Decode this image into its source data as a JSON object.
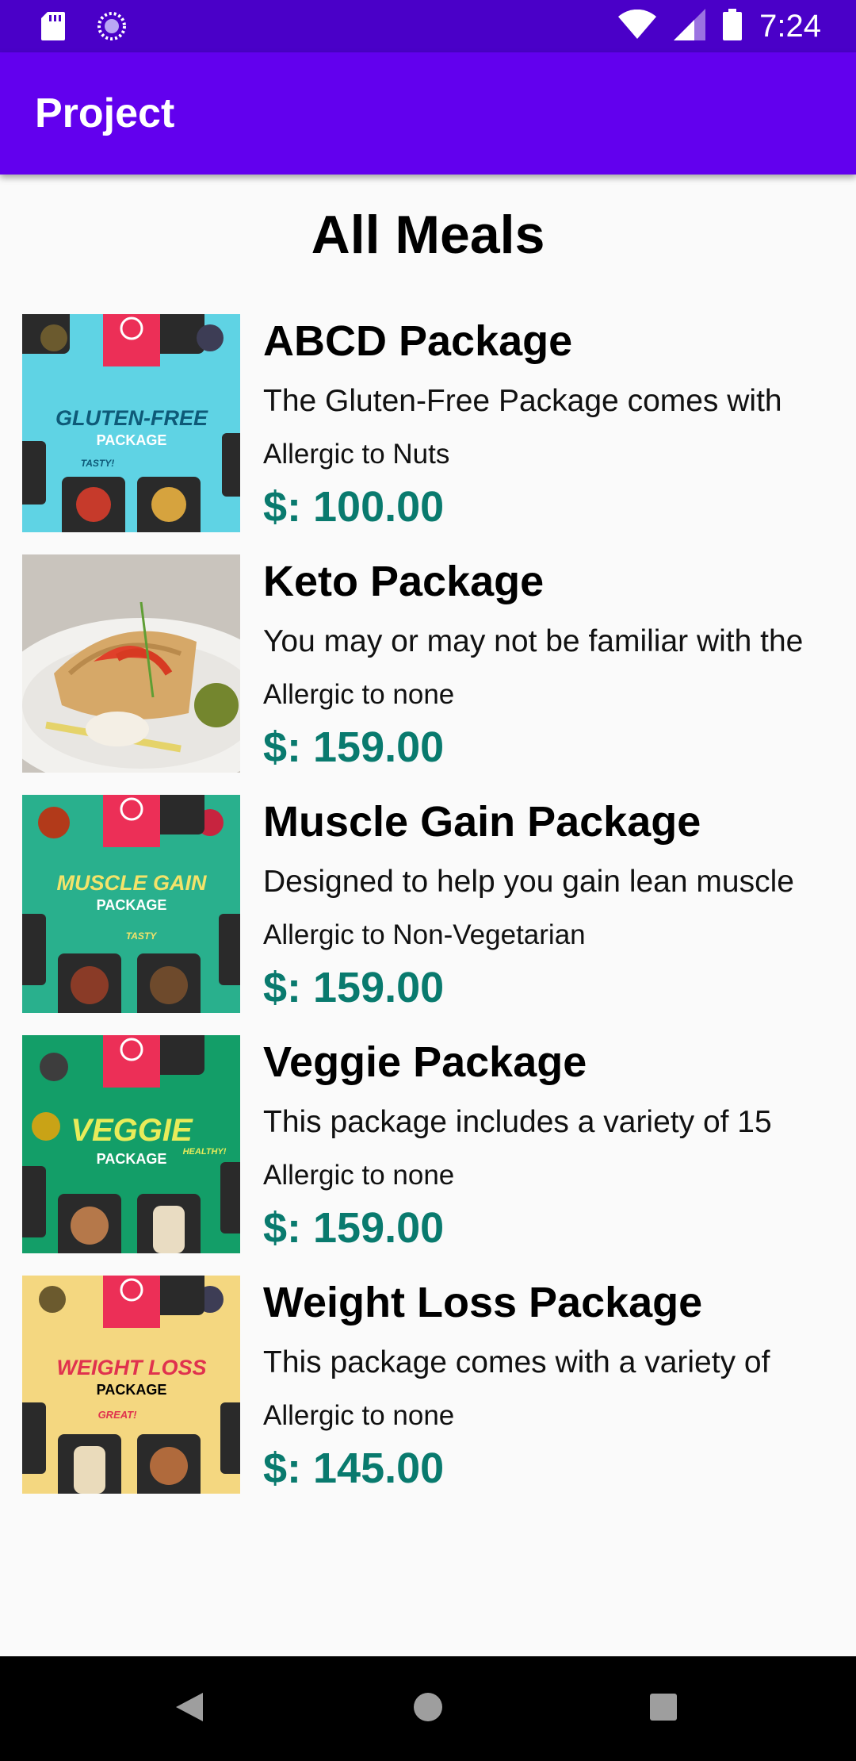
{
  "status_bar": {
    "time": "7:24",
    "icons": [
      "sd-card-icon",
      "sync-icon",
      "wifi-icon",
      "signal-icon",
      "battery-icon"
    ]
  },
  "app_bar": {
    "title": "Project"
  },
  "page": {
    "title": "All Meals"
  },
  "meals": [
    {
      "name": "ABCD Package",
      "description": "The Gluten-Free Package comes with",
      "allergy": "Allergic to Nuts",
      "price": "$: 100.00",
      "image": {
        "kind": "poster",
        "bg": "#5fd3e4",
        "line1": "GLUTEN-FREE",
        "line2": "PACKAGE",
        "line3": "TASTY!",
        "text_color": "#0e5a78"
      }
    },
    {
      "name": "Keto Package",
      "description": "You may or may not be familiar with the",
      "allergy": "Allergic to none",
      "price": "$: 159.00",
      "image": {
        "kind": "photo",
        "bg": "#d9d9d9"
      }
    },
    {
      "name": "Muscle Gain Package",
      "description": "Designed to help you gain lean muscle",
      "allergy": "Allergic to Non-Vegetarian",
      "price": "$: 159.00",
      "image": {
        "kind": "poster",
        "bg": "#29b08d",
        "line1": "MUSCLE GAIN",
        "line2": "PACKAGE",
        "line3": "TASTY",
        "text_color": "#f3e36a"
      }
    },
    {
      "name": "Veggie Package",
      "description": "This package includes a variety of 15",
      "allergy": "Allergic to none",
      "price": "$: 159.00",
      "image": {
        "kind": "poster",
        "bg": "#139e68",
        "line1": "VEGGIE",
        "line2": "PACKAGE",
        "line3": "HEALTHY!",
        "text_color": "#e8ec5a"
      }
    },
    {
      "name": "Weight Loss Package",
      "description": "This package comes with a variety of",
      "allergy": "Allergic to none",
      "price": "$: 145.00",
      "image": {
        "kind": "poster",
        "bg": "#f4d780",
        "line1": "WEIGHT LOSS",
        "line2": "PACKAGE",
        "line3": "GREAT!",
        "text_color": "#e0324e"
      }
    }
  ],
  "nav_bar": {
    "buttons": [
      "back-button",
      "home-button",
      "recents-button"
    ]
  },
  "colors": {
    "status_bar": "#4a00c8",
    "app_bar": "#6200ee",
    "price": "#097a6e",
    "background": "#fafafa"
  }
}
